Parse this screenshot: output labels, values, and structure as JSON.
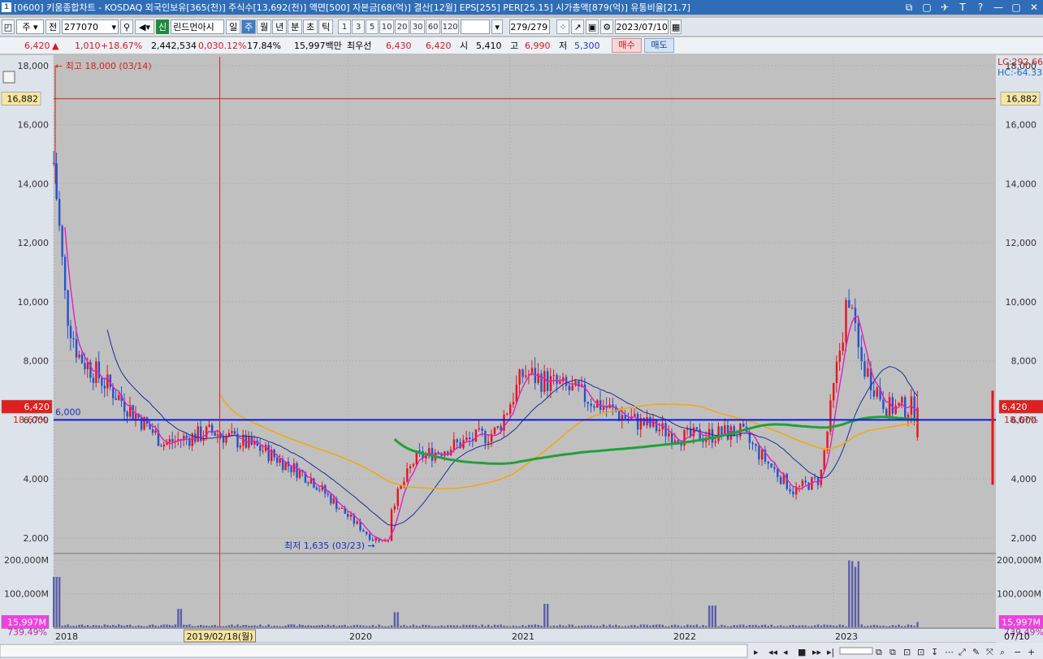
{
  "titlebar": {
    "badge": "1",
    "text": "[0600] 키움종합차트 - KOSDAQ 외국인보유[365(천)] 주식수[13,692(천)] 액면[500] 자본금[68(억)] 결산[12월] EPS[255] PER[25.15] 시가총액[879(억)] 유통비율[21.7]",
    "buttons": [
      "⧉",
      "▢",
      "✈",
      "T",
      "?",
      "—",
      "▢",
      "✕"
    ]
  },
  "toolbar": {
    "market": "주",
    "code_prefix": "전",
    "code": "277070",
    "credit_label": "신",
    "stock_name": "린드먼아시",
    "periods": [
      "일",
      "주",
      "월",
      "년",
      "분",
      "초",
      "틱"
    ],
    "selected_period": "주",
    "intervals": [
      "1",
      "3",
      "5",
      "10",
      "20",
      "30",
      "60",
      "120"
    ],
    "count": "279/279",
    "date": "2023/07/10"
  },
  "quote": {
    "price": "6,420",
    "change_arrow": "▲",
    "change": "1,010",
    "change_pct": "+18.67%",
    "volume": "2,442,534",
    "vol_ratio": "0,030.12%",
    "turnover": "17.84%",
    "amount": "15,997백만",
    "best_bid_label": "최우선",
    "best_ask": "6,430",
    "best_bid": "6,420",
    "open_label": "시",
    "open": "5,410",
    "high_label": "고",
    "high": "6,990",
    "low_label": "저",
    "low": "5,300",
    "buy_label": "매수",
    "sell_label": "매도"
  },
  "chart_panel": {
    "max_label": "최고 18,000 (03/14)",
    "min_label": "최저 1,635 (03/23)",
    "lc_label": "LC:292.66",
    "hc_label": "HC:-64.33",
    "hline_label": "16,882",
    "support_label": "6,000",
    "price_tag": "6,420",
    "pct_tag": "18.67%",
    "vol_tag": "15,997M",
    "vol_pct_tag": "739.49%",
    "cursor_date": "2019/02/18(월)",
    "last_date": "07/10",
    "y_ticks": [
      "18,000",
      "16,000",
      "14,000",
      "12,000",
      "10,000",
      "8,000",
      "6,000",
      "4,000",
      "2,000"
    ],
    "vol_ticks": [
      "200,000M",
      "100,000M"
    ],
    "x_ticks": [
      "2018",
      "2020",
      "2021",
      "2022",
      "2023"
    ],
    "colors": {
      "bg": "#c0c0c0",
      "up": "#e8141e",
      "down": "#2453c9",
      "ma5": "#e020c0",
      "ma20": "#1a2f9a",
      "ma60": "#f0a818",
      "ma120": "#22a03a",
      "support": "#0a1ae0",
      "volume": "#5b5fa8"
    }
  },
  "chart_data": {
    "type": "candlestick",
    "title": "",
    "ylim": [
      1500,
      18300
    ],
    "series": [
      {
        "name": "price_key_points",
        "x": [
          "2018-01",
          "2018-02",
          "2018-03",
          "2018-06",
          "2018-10",
          "2019-02",
          "2019-06",
          "2019-10",
          "2020-03",
          "2020-06",
          "2020-12",
          "2021-02",
          "2021-06",
          "2021-10",
          "2022-02",
          "2022-06",
          "2022-10",
          "2022-12",
          "2023-02",
          "2023-03",
          "2023-05",
          "2023-07"
        ],
        "values": [
          14700,
          9800,
          8200,
          6900,
          5200,
          5600,
          5000,
          4000,
          1900,
          4700,
          5600,
          7600,
          6900,
          6000,
          5400,
          5600,
          3600,
          4000,
          10000,
          8000,
          6400,
          6420
        ]
      }
    ],
    "support_level": 6000,
    "high_mark": 18000,
    "low_mark": 1635,
    "last_close": 6420
  }
}
